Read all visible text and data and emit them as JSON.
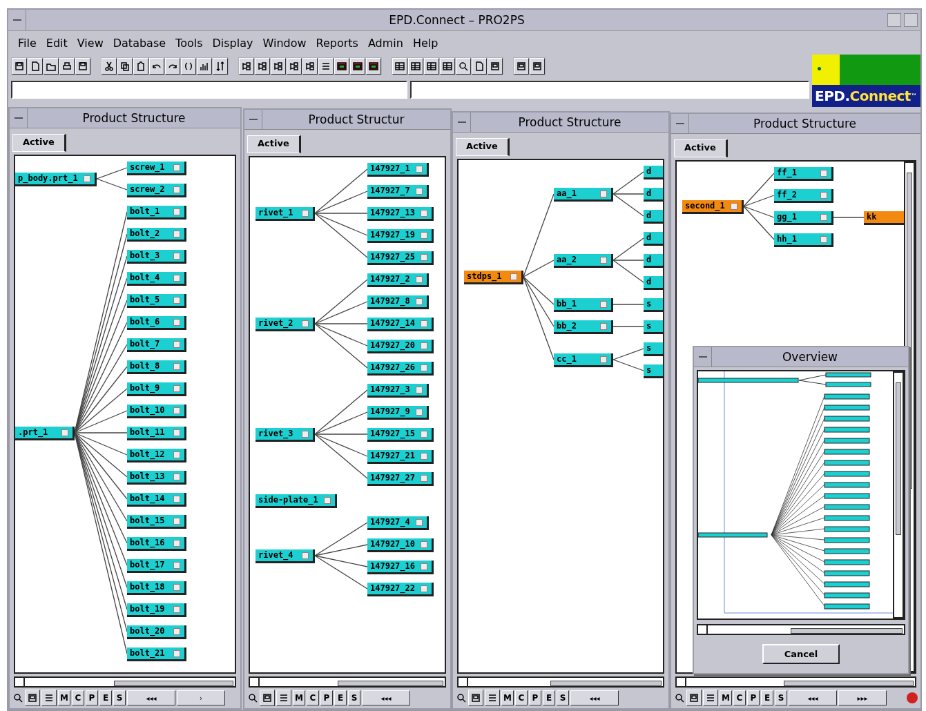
{
  "window": {
    "title": "EPD.Connect – PRO2PS"
  },
  "menu": [
    "File",
    "Edit",
    "View",
    "Database",
    "Tools",
    "Display",
    "Window",
    "Reports",
    "Admin",
    "Help"
  ],
  "logo": {
    "prefix": "EPD.",
    "name": "Connect",
    "mark": "™"
  },
  "panels": [
    {
      "title": "Product Structure",
      "tabs": [
        {
          "label": "Active",
          "selected": true
        }
      ],
      "vertical_scrollbar": false,
      "indicator": false,
      "bottom_buttons": [
        "M",
        "C",
        "P",
        "E",
        "S"
      ],
      "nav_buttons": [
        "◂◂◂",
        "›"
      ],
      "roots": [
        {
          "label": "p_body.prt_1",
          "highlighted": false,
          "children": [
            {
              "label": "screw_1",
              "highlighted": false
            },
            {
              "label": "screw_2",
              "highlighted": false
            }
          ]
        },
        {
          "label": ".prt_1",
          "highlighted": false,
          "children": [
            {
              "label": "bolt_1",
              "highlighted": false
            },
            {
              "label": "bolt_2",
              "highlighted": false
            },
            {
              "label": "bolt_3",
              "highlighted": false
            },
            {
              "label": "bolt_4",
              "highlighted": false
            },
            {
              "label": "bolt_5",
              "highlighted": false
            },
            {
              "label": "bolt_6",
              "highlighted": false
            },
            {
              "label": "bolt_7",
              "highlighted": false
            },
            {
              "label": "bolt_8",
              "highlighted": false
            },
            {
              "label": "bolt_9",
              "highlighted": false
            },
            {
              "label": "bolt_10",
              "highlighted": false
            },
            {
              "label": "bolt_11",
              "highlighted": false
            },
            {
              "label": "bolt_12",
              "highlighted": false
            },
            {
              "label": "bolt_13",
              "highlighted": false
            },
            {
              "label": "bolt_14",
              "highlighted": false
            },
            {
              "label": "bolt_15",
              "highlighted": false
            },
            {
              "label": "bolt_16",
              "highlighted": false
            },
            {
              "label": "bolt_17",
              "highlighted": false
            },
            {
              "label": "bolt_18",
              "highlighted": false
            },
            {
              "label": "bolt_19",
              "highlighted": false
            },
            {
              "label": "bolt_20",
              "highlighted": false
            },
            {
              "label": "bolt_21",
              "highlighted": false
            }
          ]
        }
      ]
    },
    {
      "title": "Product Structur",
      "tabs": [
        {
          "label": "Active",
          "selected": true
        }
      ],
      "vertical_scrollbar": false,
      "indicator": false,
      "bottom_buttons": [
        "M",
        "C",
        "P",
        "E",
        "S"
      ],
      "nav_buttons": [
        "◂◂◂"
      ],
      "roots": [
        {
          "label": "rivet_1",
          "highlighted": false,
          "children": [
            {
              "label": "147927_1",
              "highlighted": false
            },
            {
              "label": "147927_7",
              "highlighted": false
            },
            {
              "label": "147927_13",
              "highlighted": false
            },
            {
              "label": "147927_19",
              "highlighted": false
            },
            {
              "label": "147927_25",
              "highlighted": false
            }
          ]
        },
        {
          "label": "rivet_2",
          "highlighted": false,
          "children": [
            {
              "label": "147927_2",
              "highlighted": false
            },
            {
              "label": "147927_8",
              "highlighted": false
            },
            {
              "label": "147927_14",
              "highlighted": false
            },
            {
              "label": "147927_20",
              "highlighted": false
            },
            {
              "label": "147927_26",
              "highlighted": false
            }
          ]
        },
        {
          "label": "rivet_3",
          "highlighted": false,
          "children": [
            {
              "label": "147927_3",
              "highlighted": false
            },
            {
              "label": "147927_9",
              "highlighted": false
            },
            {
              "label": "147927_15",
              "highlighted": false
            },
            {
              "label": "147927_21",
              "highlighted": false
            },
            {
              "label": "147927_27",
              "highlighted": false
            }
          ]
        },
        {
          "label": "side-plate_1",
          "highlighted": false
        },
        {
          "label": "rivet_4",
          "highlighted": false,
          "children": [
            {
              "label": "147927_4",
              "highlighted": false
            },
            {
              "label": "147927_10",
              "highlighted": false
            },
            {
              "label": "147927_16",
              "highlighted": false
            },
            {
              "label": "147927_22",
              "highlighted": false
            }
          ]
        }
      ]
    },
    {
      "title": "Product Structure",
      "tabs": [
        {
          "label": "Active",
          "selected": true
        }
      ],
      "vertical_scrollbar": false,
      "indicator": false,
      "bottom_buttons": [
        "M",
        "C",
        "P",
        "E",
        "S"
      ],
      "nav_buttons": [
        "◂◂◂"
      ],
      "roots": [
        {
          "label": "stdps_1",
          "highlighted": true,
          "children": [
            {
              "label": "aa_1",
              "highlighted": false,
              "children": [
                {
                  "label": "d",
                  "highlighted": false
                },
                {
                  "label": "d",
                  "highlighted": false
                },
                {
                  "label": "d",
                  "highlighted": false
                }
              ]
            },
            {
              "label": "aa_2",
              "highlighted": false,
              "children": [
                {
                  "label": "d",
                  "highlighted": false
                },
                {
                  "label": "d",
                  "highlighted": false
                },
                {
                  "label": "d",
                  "highlighted": false
                }
              ]
            },
            {
              "label": "bb_1",
              "highlighted": false,
              "children": [
                {
                  "label": "s",
                  "highlighted": false
                }
              ]
            },
            {
              "label": "bb_2",
              "highlighted": false,
              "children": [
                {
                  "label": "s",
                  "highlighted": false
                }
              ]
            },
            {
              "label": "cc_1",
              "highlighted": false,
              "children": [
                {
                  "label": "s",
                  "highlighted": false
                },
                {
                  "label": "s",
                  "highlighted": false
                }
              ]
            }
          ]
        }
      ]
    },
    {
      "title": "Product Structure",
      "tabs": [
        {
          "label": "Active",
          "selected": true
        }
      ],
      "vertical_scrollbar": true,
      "indicator": true,
      "bottom_buttons": [
        "M",
        "C",
        "P",
        "E",
        "S"
      ],
      "nav_buttons": [
        "◂◂◂",
        "▸▸▸"
      ],
      "roots": [
        {
          "label": "second_1",
          "highlighted": true,
          "children": [
            {
              "label": "ff_1",
              "highlighted": false
            },
            {
              "label": "ff_2",
              "highlighted": false
            },
            {
              "label": "gg_1",
              "highlighted": false,
              "children": [
                {
                  "label": "kk",
                  "highlighted": true
                }
              ]
            },
            {
              "label": "hh_1",
              "highlighted": false
            }
          ]
        }
      ]
    }
  ],
  "overview": {
    "title": "Overview",
    "cancel": "Cancel"
  }
}
